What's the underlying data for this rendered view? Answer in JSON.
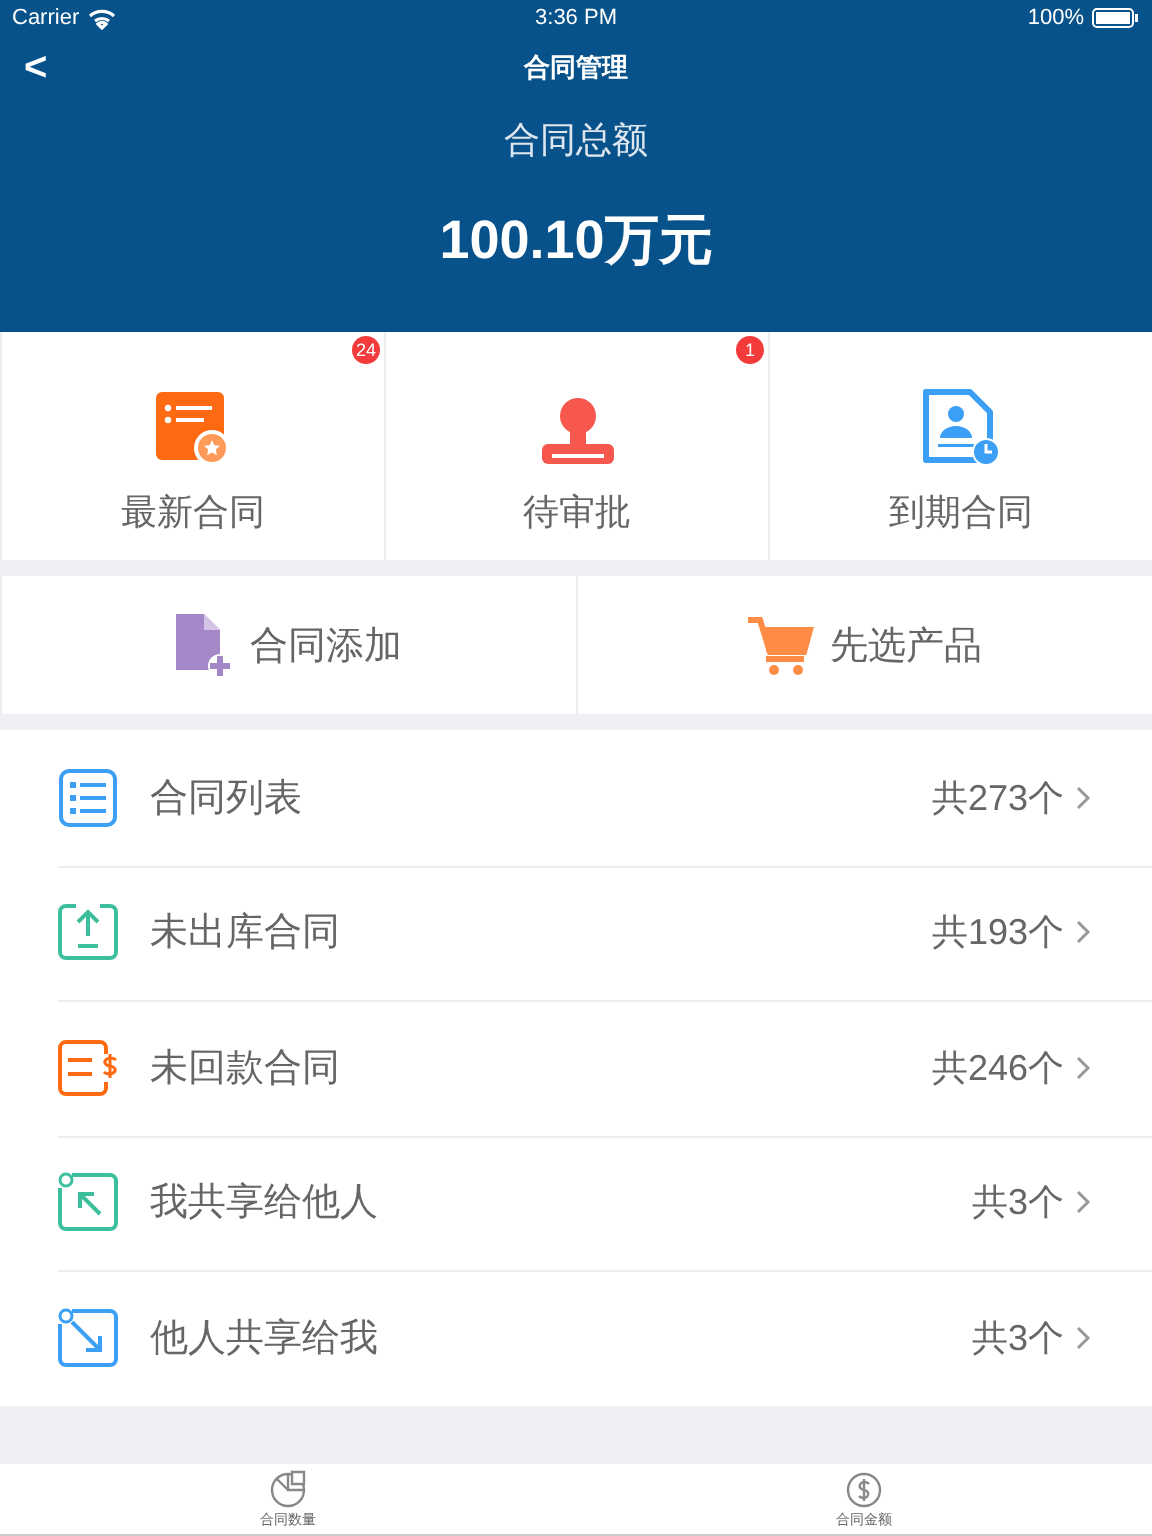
{
  "status_bar": {
    "carrier": "Carrier",
    "time": "3:36 PM",
    "battery": "100%"
  },
  "nav": {
    "back": "<",
    "title": "合同管理"
  },
  "summary": {
    "label": "合同总额",
    "amount": "100.10万元"
  },
  "tiles": [
    {
      "label": "最新合同",
      "badge": "24"
    },
    {
      "label": "待审批",
      "badge": "1"
    },
    {
      "label": "到期合同"
    }
  ],
  "actions": [
    {
      "label": "合同添加"
    },
    {
      "label": "先选产品"
    }
  ],
  "list": [
    {
      "label": "合同列表",
      "count": "共273个"
    },
    {
      "label": "未出库合同",
      "count": "共193个"
    },
    {
      "label": "未回款合同",
      "count": "共246个"
    },
    {
      "label": "我共享给他人",
      "count": "共3个"
    },
    {
      "label": "他人共享给我",
      "count": "共3个"
    }
  ],
  "tab_bar": [
    {
      "label": "合同数量"
    },
    {
      "label": "合同金额"
    }
  ]
}
